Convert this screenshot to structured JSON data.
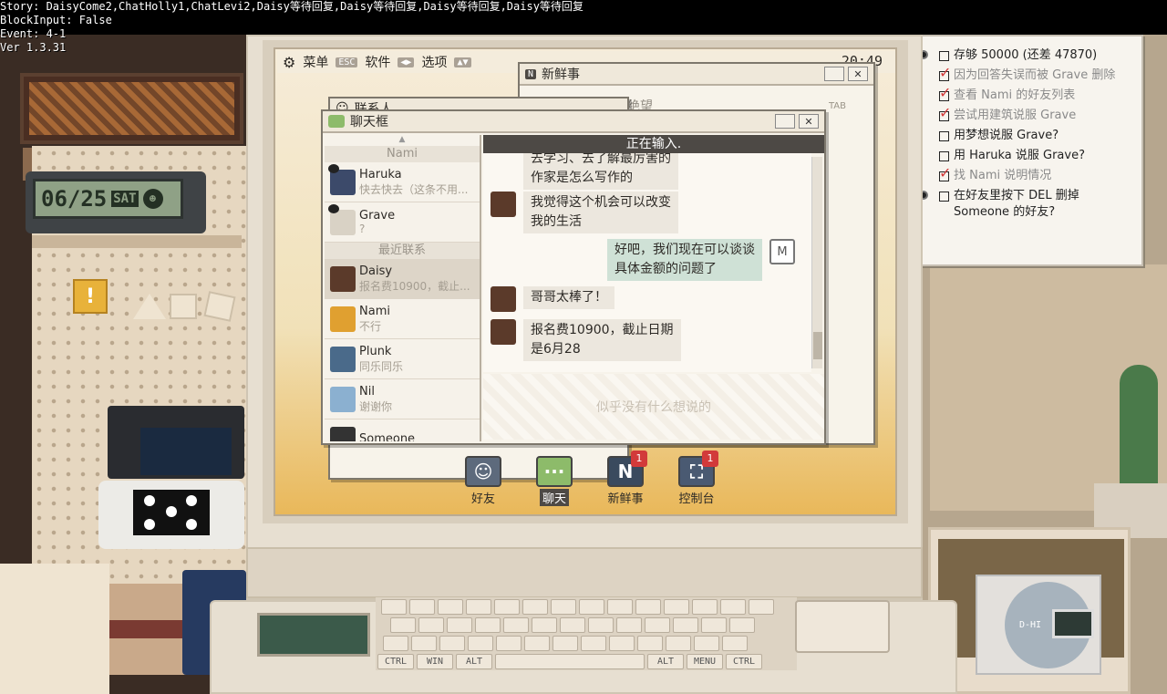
{
  "debug": {
    "story": "Story: DaisyCome2,ChatHolly1,ChatLevi2,Daisy等待回复,Daisy等待回复,Daisy等待回复,Daisy等待回复",
    "block_input": "BlockInput: False",
    "event": "Event: 4-1",
    "version": "Ver 1.3.31"
  },
  "desk_clock": {
    "date": "06/25",
    "day": "SAT"
  },
  "os": {
    "menu_label": "菜单",
    "menu_key": "ESC",
    "software_label": "软件",
    "options_label": "选项",
    "time": "20:49"
  },
  "news_window": {
    "title": "新鲜事",
    "item_text": "电子生物男的绝望",
    "item_tag": "TAB"
  },
  "contacts_window": {
    "title": "联系人"
  },
  "chat_window": {
    "title": "聊天框",
    "typing_status": "正在输入.",
    "reply_placeholder": "似乎没有什么想说的",
    "sections": {
      "pinned": "Nami",
      "recent": "最近联系"
    },
    "contacts": [
      {
        "name": "Haruka",
        "preview": "快去快去（这条不用...",
        "color": "#3c4a6a"
      },
      {
        "name": "Grave",
        "preview": "?",
        "color": "#d9d2c5"
      },
      {
        "name": "Daisy",
        "preview": "报名费10900，截止...",
        "color": "#5b3a2a"
      },
      {
        "name": "Nami",
        "preview": "不行",
        "color": "#e0a030"
      },
      {
        "name": "Plunk",
        "preview": "同乐同乐",
        "color": "#4a6a8a"
      },
      {
        "name": "Nil",
        "preview": "谢谢你",
        "color": "#8bb0d0"
      },
      {
        "name": "Someone",
        "preview": "",
        "color": "#333333"
      }
    ],
    "messages": [
      {
        "from": "daisy",
        "text_1": "去学习、去了解最厉害的",
        "text_2": "作家是怎么写作的"
      },
      {
        "from": "daisy",
        "text_1": "我觉得这个机会可以改变",
        "text_2": "我的生活"
      },
      {
        "from": "me",
        "text_1": "好吧，我们现在可以谈谈",
        "text_2": "具体金额的问题了",
        "avatar_letter": "M"
      },
      {
        "from": "daisy",
        "text_1": "哥哥太棒了！",
        "text_2": ""
      },
      {
        "from": "daisy",
        "text_1": "报名费10900，截止日期",
        "text_2": "是6月28"
      }
    ]
  },
  "dock": {
    "friends": {
      "label": "好友",
      "icon": "person-icon"
    },
    "chat": {
      "label": "聊天",
      "icon": "chat-bubble-icon"
    },
    "news": {
      "label": "新鲜事",
      "icon": "n-logo-icon",
      "badge": "1"
    },
    "console": {
      "label": "控制台",
      "icon": "console-icon",
      "badge": "1"
    }
  },
  "checklist": [
    {
      "text": "存够 50000 (还差 47870)",
      "done": false
    },
    {
      "text": "因为回答失误而被 Grave 删除",
      "done": true
    },
    {
      "text": "查看 Nami 的好友列表",
      "done": true
    },
    {
      "text": "尝试用建筑说服 Grave",
      "done": true
    },
    {
      "text": "用梦想说服 Grave?",
      "done": false
    },
    {
      "text": "用 Haruka 说服 Grave?",
      "done": false
    },
    {
      "text": "找 Nami 说明情况",
      "done": true
    },
    {
      "text": "在好友里按下 DEL 删掉 Someone 的好友?",
      "done": false
    }
  ],
  "keyboard": {
    "ctrl_left": "CTRL",
    "win": "WIN",
    "alt_left": "ALT",
    "alt_right": "ALT",
    "menu": "MENU",
    "ctrl_right": "CTRL"
  },
  "walkman_label": "D-HI",
  "colors": {
    "accent": "#4d4945",
    "badge": "#d23a3a",
    "check": "#d23a3a"
  }
}
